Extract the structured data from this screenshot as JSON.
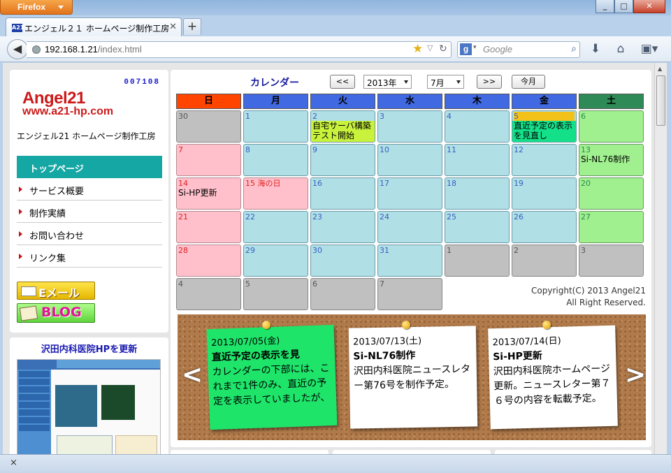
{
  "browser": {
    "menu_button": "Firefox",
    "tab_title": "エンジェル２１ ホームページ制作工房",
    "url_host": "192.168.1.21",
    "url_path": "/index.html",
    "search_placeholder": "Google",
    "new_tab": "+",
    "status_close": "×"
  },
  "sidebar": {
    "counter": "007108",
    "logo_line1": "Angel21",
    "logo_line2": "www.a21-hp.com",
    "site_name": "エンジェル21 ホームページ制作工房",
    "menu": [
      {
        "label": "トップページ",
        "active": true
      },
      {
        "label": "サービス概要"
      },
      {
        "label": "制作実績"
      },
      {
        "label": "お問い合わせ"
      },
      {
        "label": "リンク集"
      }
    ],
    "email_button": "Eメール",
    "blog_button": "BLOG",
    "promo_title": "沢田内科医院HPを更新"
  },
  "calendar": {
    "title": "カレンダー",
    "prev": "<<",
    "next": ">>",
    "year": "2013年",
    "month": "7月",
    "today": "今月",
    "days": [
      "日",
      "月",
      "火",
      "水",
      "木",
      "金",
      "土"
    ],
    "weeks": [
      [
        {
          "n": "30",
          "t": "oth"
        },
        {
          "n": "1"
        },
        {
          "n": "2",
          "e": "自宅サーバ構築テスト開始",
          "hl": "#c8f23c"
        },
        {
          "n": "3"
        },
        {
          "n": "4"
        },
        {
          "n": "5",
          "e": "直近予定の表示を見直し",
          "hl": "#14e08a",
          "nbg": "#f2c21a"
        },
        {
          "n": "6",
          "t": "sat"
        }
      ],
      [
        {
          "n": "7",
          "t": "sun"
        },
        {
          "n": "8"
        },
        {
          "n": "9"
        },
        {
          "n": "10"
        },
        {
          "n": "11"
        },
        {
          "n": "12"
        },
        {
          "n": "13",
          "t": "sat",
          "e": "Si-NL76制作"
        }
      ],
      [
        {
          "n": "14",
          "t": "sun",
          "e": "Si-HP更新"
        },
        {
          "n": "15 海の日",
          "t": "sun"
        },
        {
          "n": "16"
        },
        {
          "n": "17"
        },
        {
          "n": "18"
        },
        {
          "n": "19"
        },
        {
          "n": "20",
          "t": "sat"
        }
      ],
      [
        {
          "n": "21",
          "t": "sun"
        },
        {
          "n": "22"
        },
        {
          "n": "23"
        },
        {
          "n": "24"
        },
        {
          "n": "25"
        },
        {
          "n": "26"
        },
        {
          "n": "27",
          "t": "sat"
        }
      ],
      [
        {
          "n": "28",
          "t": "sun"
        },
        {
          "n": "29"
        },
        {
          "n": "30"
        },
        {
          "n": "31"
        },
        {
          "n": "1",
          "t": "oth"
        },
        {
          "n": "2",
          "t": "oth"
        },
        {
          "n": "3",
          "t": "oth"
        }
      ],
      [
        {
          "n": "4",
          "t": "oth"
        },
        {
          "n": "5",
          "t": "oth"
        },
        {
          "n": "6",
          "t": "oth"
        },
        {
          "n": "7",
          "t": "oth"
        }
      ]
    ],
    "copyright1": "Copyright(C) 2013 Angel21",
    "copyright2": "All Right Reserved."
  },
  "notes": [
    {
      "date": "2013/07/05(金)",
      "title": "直近予定の表示を見",
      "body": "カレンダーの下部には、これまで1件のみ、直近の予定を表示していましたが、",
      "color": "#1ee56a"
    },
    {
      "date": "2013/07/13(土)",
      "title": "Si-NL76制作",
      "body": "沢田内科医院ニュースレター第76号を制作予定。",
      "color": "#ffffff"
    },
    {
      "date": "2013/07/14(日)",
      "title": "Si-HP更新",
      "body": "沢田内科医院ホームページ更新。ニュースレター第７６号の内容を転載予定。",
      "color": "#ffffff"
    }
  ],
  "slider": {
    "prev": "<",
    "next": ">"
  },
  "colors": {
    "sun_header": "#ff4500",
    "weekday_header": "#4169e1",
    "sat_header": "#2e8b57",
    "menu_active": "#15a7a4"
  }
}
